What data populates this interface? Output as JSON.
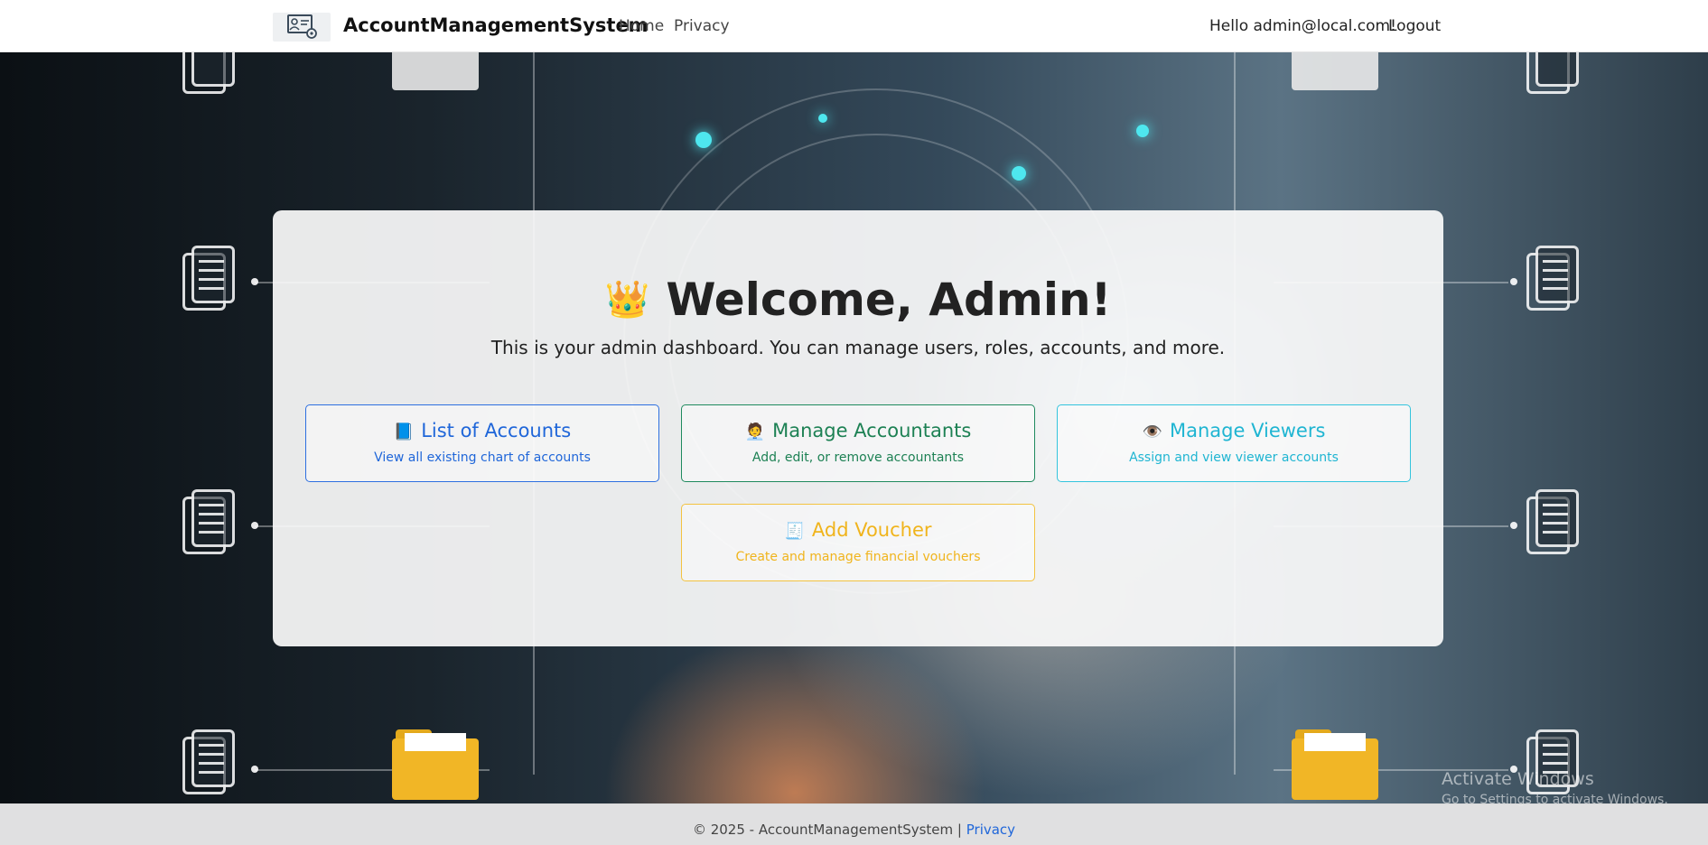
{
  "navbar": {
    "logo_icon": "account-card-gear-icon",
    "brand": "AccountManagementSystem",
    "links": [
      {
        "label": "Home"
      },
      {
        "label": "Privacy"
      }
    ],
    "greeting": "Hello admin@local.com!",
    "logout_label": "Logout"
  },
  "dashboard": {
    "welcome_emoji": "👑",
    "welcome_title": "Welcome, Admin!",
    "subtitle": "This is your admin dashboard. You can manage users, roles, accounts, and more.",
    "tiles": [
      {
        "icon": "📘",
        "title": "List of Accounts",
        "description": "View all existing chart of accounts",
        "color": "#1f66d9"
      },
      {
        "icon": "🧑‍💼",
        "title": "Manage Accountants",
        "description": "Add, edit, or remove accountants",
        "color": "#1d8154"
      },
      {
        "icon": "👁️",
        "title": "Manage Viewers",
        "description": "Assign and view viewer accounts",
        "color": "#1fb5d2"
      },
      {
        "icon": "🧾",
        "title": "Add Voucher",
        "description": "Create and manage financial vouchers",
        "color": "#f0b41c"
      }
    ]
  },
  "footer": {
    "copyright": "© 2025 - AccountManagementSystem |",
    "privacy_link": "Privacy"
  },
  "watermark": {
    "line1": "Activate Windows",
    "line2": "Go to Settings to activate Windows."
  }
}
